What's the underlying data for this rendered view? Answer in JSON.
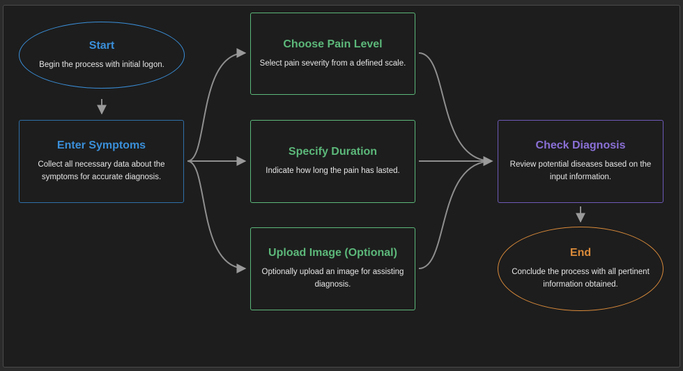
{
  "colors": {
    "blue": "#3a8fd9",
    "green": "#5cb87a",
    "purple": "#8a70d6",
    "orange": "#d98a3a",
    "edge": "#9a9a9a"
  },
  "nodes": {
    "start": {
      "title": "Start",
      "desc": "Begin the process with initial logon."
    },
    "enter_symptoms": {
      "title": "Enter Symptoms",
      "desc": "Collect all necessary data about the symptoms for accurate diagnosis."
    },
    "choose_pain": {
      "title": "Choose Pain Level",
      "desc": "Select pain severity from a defined scale."
    },
    "specify_duration": {
      "title": "Specify Duration",
      "desc": "Indicate how long the pain has lasted."
    },
    "upload_image": {
      "title": "Upload Image (Optional)",
      "desc": "Optionally upload an image for assisting diagnosis."
    },
    "check_diagnosis": {
      "title": "Check Diagnosis",
      "desc": "Review potential diseases based on the input information."
    },
    "end": {
      "title": "End",
      "desc": "Conclude the process with all pertinent information obtained."
    }
  }
}
